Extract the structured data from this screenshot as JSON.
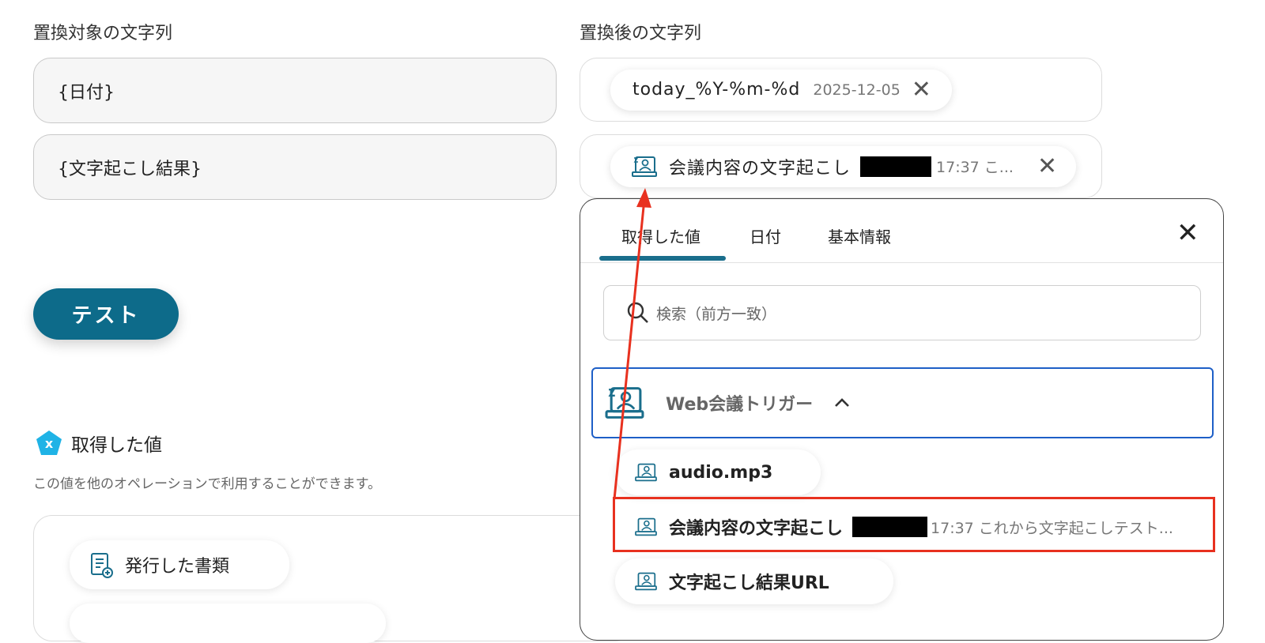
{
  "left": {
    "target_label": "置換対象の文字列",
    "target_fields": [
      "{日付}",
      "{文字起こし結果}"
    ],
    "test_button": "テスト",
    "acquired_title": "取得した値",
    "acquired_desc": "この値を他のオペレーションで利用することができます。",
    "acquired_items": [
      "発行した書類"
    ]
  },
  "right": {
    "replace_label": "置換後の文字列",
    "chip1": {
      "token": "today_%Y-%m-%d",
      "value": "2025-12-05"
    },
    "chip2": {
      "token": "会議内容の文字起こし",
      "value": "17:37 こ..."
    }
  },
  "picker": {
    "tabs": [
      "取得した値",
      "日付",
      "基本情報"
    ],
    "active_tab": 0,
    "search_placeholder": "検索（前方一致）",
    "group_name": "Web会議トリガー",
    "items": [
      {
        "name": "audio.mp3",
        "value": ""
      },
      {
        "name": "会議内容の文字起こし",
        "value": "17:37 これから文字起こしテスト..."
      },
      {
        "name": "文字起こし結果URL",
        "value": ""
      }
    ]
  },
  "colors": {
    "accent": "#0d6b8a",
    "highlight": "#e8311f",
    "group_border": "#1e5fc7",
    "icon": "#1a6e8c"
  }
}
